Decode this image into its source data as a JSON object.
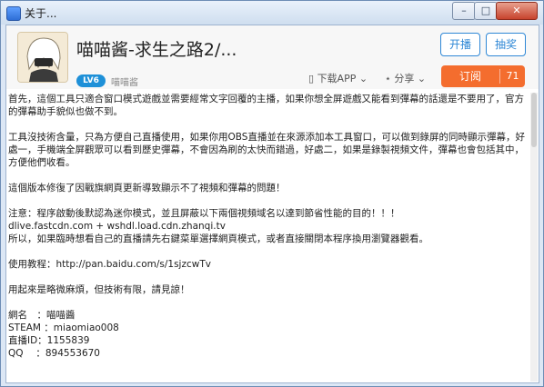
{
  "window": {
    "title": "关于..."
  },
  "header": {
    "stream_title": "喵喵酱-求生之路2/...",
    "level": "LV6",
    "username": "喵喵酱",
    "buttons": {
      "live": "开播",
      "lottery": "抽奖"
    },
    "download_app": "下载APP",
    "share": "分享",
    "follow_label": "订阅",
    "follow_count": "71"
  },
  "content": {
    "paragraphs": [
      "首先，這個工具只適合窗口模式遊戲並需要經常文字回覆的主播，如果你想全屏遊戲又能看到彈幕的話還是不要用了，官方的彈幕助手貌似也做不到。",
      "工具沒技術含量，只為方便自己直播使用，如果你用OBS直播並在來源添加本工具窗口，可以做到錄屏的同時顯示彈幕，好處一，手機端全屏觀眾可以看到歷史彈幕，不會因為刷的太快而錯過，好處二，如果是錄製視頻文件，彈幕也會包括其中，方便他們收看。",
      "這個版本修復了因戰旗網頁更新導致顯示不了視頻和彈幕的問題！",
      "注意：程序啟動後默認為迷你模式，並且屏蔽以下兩個視頻域名以達到節省性能的目的！！！\ndlive.fastcdn.com + wshdl.load.cdn.zhanqi.tv\n所以，如果臨時想看自己的直播請先右鍵菜單選擇網頁模式，或者直接關閉本程序換用瀏覽器觀看。",
      "使用教程：http://pan.baidu.com/s/1sjzcwTv",
      "用起來是略微麻煩，但技術有限，請見諒！",
      "網名　：喵喵醬\nSTEAM ：miaomiao008\n直播ID：1155839\nQQ　 ：894553670"
    ]
  }
}
